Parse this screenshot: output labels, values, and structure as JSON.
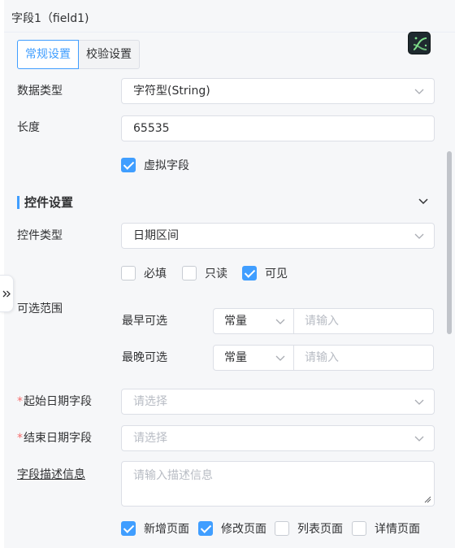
{
  "header": {
    "title": "字段1（field1)"
  },
  "tabs": [
    {
      "label": "常规设置",
      "active": true
    },
    {
      "label": "校验设置",
      "active": false
    }
  ],
  "form": {
    "data_type": {
      "label": "数据类型",
      "value": "字符型(String)"
    },
    "length": {
      "label": "长度",
      "value": "65535"
    },
    "virtual_field": {
      "label": "虚拟字段",
      "checked": true
    }
  },
  "control_section": {
    "title": "控件设置",
    "control_type": {
      "label": "控件类型",
      "value": "日期区间"
    },
    "flags": [
      {
        "label": "必填",
        "checked": false
      },
      {
        "label": "只读",
        "checked": false
      },
      {
        "label": "可见",
        "checked": true
      }
    ],
    "range": {
      "label": "可选范围",
      "earliest": {
        "label": "最早可选",
        "mode": "常量",
        "placeholder": "请输入"
      },
      "latest": {
        "label": "最晚可选",
        "mode": "常量",
        "placeholder": "请输入"
      }
    },
    "start_field": {
      "label": "起始日期字段",
      "placeholder": "请选择",
      "required": true
    },
    "end_field": {
      "label": "结束日期字段",
      "placeholder": "请选择",
      "required": true
    },
    "description": {
      "label": "字段描述信息",
      "placeholder": "请输入描述信息"
    },
    "pages": [
      {
        "label": "新增页面",
        "checked": true
      },
      {
        "label": "修改页面",
        "checked": true
      },
      {
        "label": "列表页面",
        "checked": false
      },
      {
        "label": "详情页面",
        "checked": false
      }
    ]
  },
  "colors": {
    "accent": "#409eff",
    "required": "#f56c6c",
    "border": "#dcdfe6",
    "placeholder": "#b8bcc4"
  },
  "icons": {
    "app": "curve-logo-icon",
    "collapse": "chevron-down-icon",
    "dropdown": "chevron-down-icon",
    "side_toggle": "double-chevron-right-icon"
  }
}
